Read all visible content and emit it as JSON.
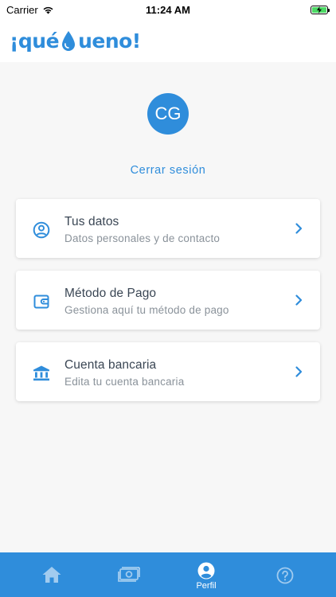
{
  "status_bar": {
    "carrier": "Carrier",
    "time": "11:24 AM"
  },
  "header": {
    "logo_prefix": "¡qué",
    "logo_suffix": "ueno!"
  },
  "profile": {
    "initials": "CG",
    "logout_label": "Cerrar sesión"
  },
  "menu": [
    {
      "icon": "user-circle-icon",
      "title": "Tus datos",
      "subtitle": "Datos personales y de contacto"
    },
    {
      "icon": "wallet-icon",
      "title": "Método de Pago",
      "subtitle": "Gestiona aquí tu método de pago"
    },
    {
      "icon": "bank-icon",
      "title": "Cuenta bancaria",
      "subtitle": "Edita tu cuenta bancaria"
    }
  ],
  "tabbar": {
    "tabs": [
      {
        "icon": "home-icon",
        "label": ""
      },
      {
        "icon": "money-icon",
        "label": ""
      },
      {
        "icon": "profile-icon",
        "label": "Perfil",
        "active": true
      },
      {
        "icon": "help-icon",
        "label": ""
      }
    ]
  },
  "colors": {
    "brand": "#2f8ddb",
    "background": "#f7f7f7",
    "text": "#3a4654",
    "muted": "#8a929a"
  }
}
